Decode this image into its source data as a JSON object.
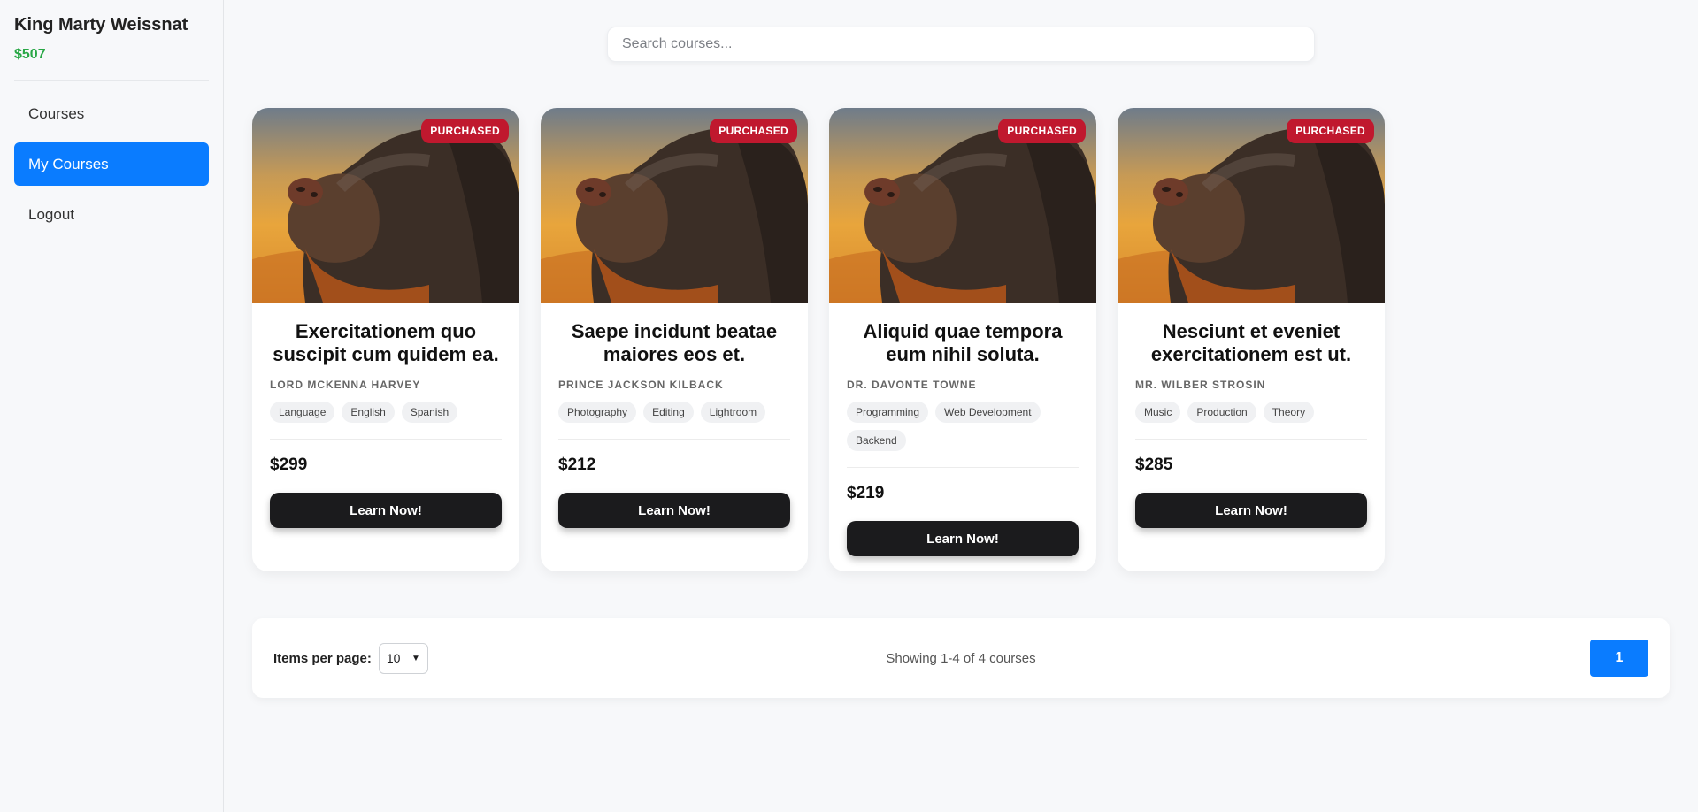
{
  "user": {
    "name": "King Marty Weissnat",
    "balance": "$507"
  },
  "nav": {
    "items": [
      {
        "label": "Courses",
        "active": false
      },
      {
        "label": "My Courses",
        "active": true
      },
      {
        "label": "Logout",
        "active": false
      }
    ]
  },
  "search": {
    "placeholder": "Search courses..."
  },
  "courses": [
    {
      "badge": "PURCHASED",
      "title": "Exercitationem quo suscipit cum quidem ea.",
      "author": "LORD MCKENNA HARVEY",
      "tags": [
        "Language",
        "English",
        "Spanish"
      ],
      "price": "$299",
      "button": "Learn Now!"
    },
    {
      "badge": "PURCHASED",
      "title": "Saepe incidunt beatae maiores eos et.",
      "author": "PRINCE JACKSON KILBACK",
      "tags": [
        "Photography",
        "Editing",
        "Lightroom"
      ],
      "price": "$212",
      "button": "Learn Now!"
    },
    {
      "badge": "PURCHASED",
      "title": "Aliquid quae tempora eum nihil soluta.",
      "author": "DR. DAVONTE TOWNE",
      "tags": [
        "Programming",
        "Web Development",
        "Backend"
      ],
      "price": "$219",
      "button": "Learn Now!"
    },
    {
      "badge": "PURCHASED",
      "title": "Nesciunt et eveniet exercitationem est ut.",
      "author": "MR. WILBER STROSIN",
      "tags": [
        "Music",
        "Production",
        "Theory"
      ],
      "price": "$285",
      "button": "Learn Now!"
    }
  ],
  "pagination": {
    "items_per_page_label": "Items per page:",
    "items_per_page_value": "10",
    "showing_text": "Showing 1-4 of 4 courses",
    "current_page": "1"
  },
  "colors": {
    "accent": "#0a7cff",
    "balance": "#28a745",
    "badge": "#c0182e",
    "button": "#1b1b1d"
  }
}
